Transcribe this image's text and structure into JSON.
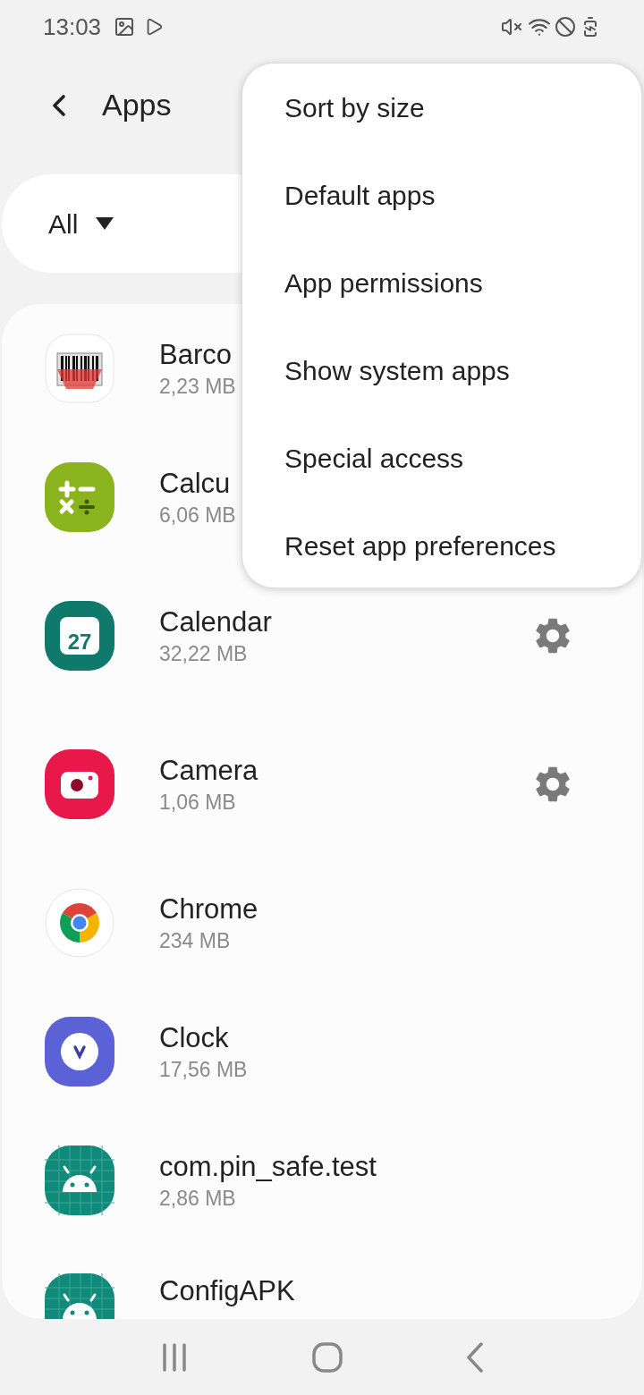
{
  "status_bar": {
    "time": "13:03"
  },
  "header": {
    "title": "Apps"
  },
  "filter": {
    "label": "All"
  },
  "apps": [
    {
      "name": "Barco",
      "size": "2,23 MB",
      "kind": "barcode",
      "settings": false
    },
    {
      "name": "Calcu",
      "size": "6,06 MB",
      "kind": "calculator",
      "settings": false
    },
    {
      "name": "Calendar",
      "size": "32,22 MB",
      "kind": "calendar",
      "icon_text": "27",
      "settings": true
    },
    {
      "name": "Camera",
      "size": "1,06 MB",
      "kind": "camera",
      "settings": true
    },
    {
      "name": "Chrome",
      "size": "234 MB",
      "kind": "chrome",
      "settings": false
    },
    {
      "name": "Clock",
      "size": "17,56 MB",
      "kind": "clock",
      "settings": false
    },
    {
      "name": "com.pin_safe.test",
      "size": "2,86 MB",
      "kind": "android",
      "settings": false
    },
    {
      "name": "ConfigAPK",
      "kind": "android",
      "settings": false
    }
  ],
  "menu": [
    "Sort by size",
    "Default apps",
    "App permissions",
    "Show system apps",
    "Special access",
    "Reset app preferences"
  ]
}
